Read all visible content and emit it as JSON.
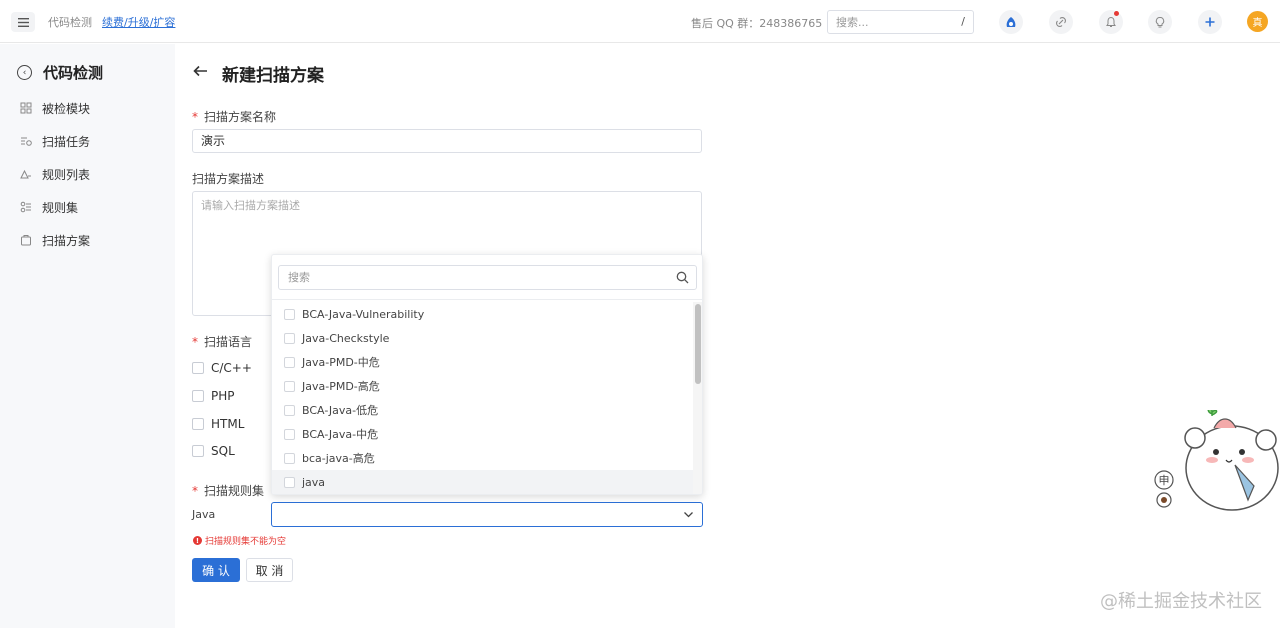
{
  "topbar": {
    "menu_icon": "hamburger-icon",
    "app_title": "代码检测",
    "upgrade_link": "续费/升级/扩容",
    "qq_text": "售后 QQ 群：248386765",
    "search_placeholder": "搜索...",
    "search_shortcut": "/",
    "avatar_text": "真",
    "icons": [
      "app-icon",
      "link-icon",
      "bell-icon",
      "lightbulb-icon",
      "plus-icon"
    ]
  },
  "sidebar": {
    "title": "代码检测",
    "items": [
      {
        "label": "被检模块",
        "icon": "modules-icon"
      },
      {
        "label": "扫描任务",
        "icon": "tasks-icon"
      },
      {
        "label": "规则列表",
        "icon": "rules-icon"
      },
      {
        "label": "规则集",
        "icon": "ruleset-icon"
      },
      {
        "label": "扫描方案",
        "icon": "scheme-icon"
      }
    ]
  },
  "main": {
    "page_title": "新建扫描方案",
    "name_label": "扫描方案名称",
    "name_value": "演示",
    "desc_label": "扫描方案描述",
    "desc_placeholder": "请输入扫描方案描述",
    "lang_label": "扫描语言",
    "languages": [
      {
        "label": "C/C++",
        "checked": false
      },
      {
        "label": "PHP",
        "checked": false
      },
      {
        "label": "HTML",
        "checked": false
      },
      {
        "label": "SQL",
        "checked": false
      }
    ],
    "ruleset_label": "扫描规则集",
    "java_label": "Java",
    "error_text": "扫描规则集不能为空",
    "confirm_button": "确 认",
    "cancel_button": "取 消"
  },
  "dropdown": {
    "search_placeholder": "搜索",
    "options": [
      "BCA-Java-Vulnerability",
      "Java-Checkstyle",
      "Java-PMD-中危",
      "Java-PMD-高危",
      "BCA-Java-低危",
      "BCA-Java-中危",
      "bca-java-高危",
      "java"
    ],
    "hovered_index": 7
  },
  "watermark": "@稀土掘金技术社区",
  "colors": {
    "primary": "#2b6fd6",
    "error": "#e53935",
    "sidebar_bg": "#f7f8fa",
    "avatar": "#f5a623"
  }
}
